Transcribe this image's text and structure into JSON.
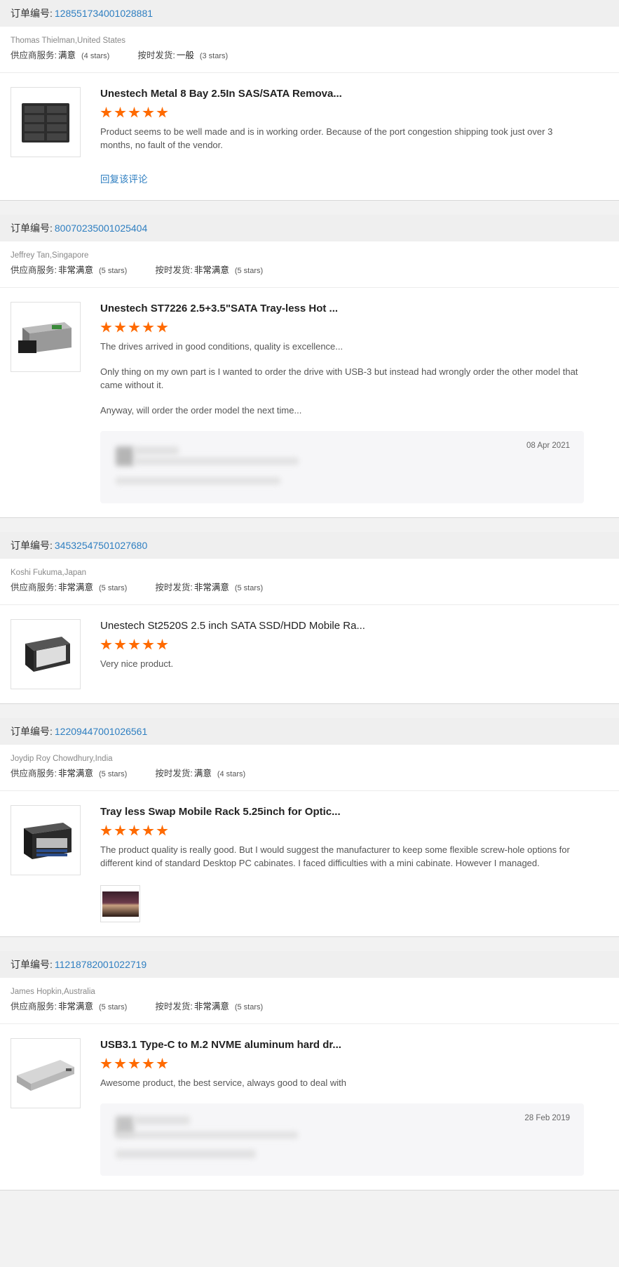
{
  "labels": {
    "order_no": "订单编号:",
    "supplier_service": "供应商服务:",
    "on_time": "按时发货:",
    "reply": "回复该评论"
  },
  "colors": {
    "accent": "#2f7fc1",
    "star": "#ff6a00",
    "header_bg": "#efefef"
  },
  "orders": [
    {
      "order_number": "128551734001028881",
      "buyer": "Thomas Thielman,United States",
      "service": {
        "value": "满意",
        "stars": "(4 stars)"
      },
      "shipping": {
        "value": "一般",
        "stars": "(3 stars)"
      },
      "product_title": "Unestech Metal 8 Bay 2.5In SAS/SATA Remova...",
      "rating": 5,
      "text": [
        "Product seems to be well made and is in working order. Because of the port congestion shipping took just over 3 months, no fault of the vendor."
      ],
      "has_reply_link": true
    },
    {
      "order_number": "80070235001025404",
      "buyer": "Jeffrey Tan,Singapore",
      "service": {
        "value": "非常满意",
        "stars": "(5 stars)"
      },
      "shipping": {
        "value": "非常满意",
        "stars": "(5 stars)"
      },
      "product_title": "Unestech ST7226 2.5+3.5\"SATA Tray-less Hot ...",
      "rating": 5,
      "text": [
        "The drives arrived in good conditions, quality is excellence...",
        "Only thing on my own part is I wanted to order the drive with USB-3 but instead had wrongly order the other model that came without it.",
        "Anyway, will order the order model the next time..."
      ],
      "seller_reply_date": "08 Apr 2021"
    },
    {
      "order_number": "34532547501027680",
      "buyer": "Koshi Fukuma,Japan",
      "service": {
        "value": "非常满意",
        "stars": "(5 stars)"
      },
      "shipping": {
        "value": "非常满意",
        "stars": "(5 stars)"
      },
      "product_title": "Unestech St2520S 2.5 inch SATA SSD/HDD Mobile Ra...",
      "rating": 5,
      "text": [
        "Very nice product."
      ]
    },
    {
      "order_number": "12209447001026561",
      "buyer": "Joydip Roy Chowdhury,India",
      "service": {
        "value": "非常满意",
        "stars": "(5 stars)"
      },
      "shipping": {
        "value": "满意",
        "stars": "(4 stars)"
      },
      "product_title": "Tray less Swap Mobile Rack 5.25inch for Optic...",
      "rating": 5,
      "text": [
        "The product quality is really good. But I would suggest the manufacturer to keep some flexible screw-hole options for different kind of standard Desktop PC cabinates. I faced difficulties with a mini cabinate. However I managed."
      ],
      "has_photo": true
    },
    {
      "order_number": "11218782001022719",
      "buyer": "James Hopkin,Australia",
      "service": {
        "value": "非常满意",
        "stars": "(5 stars)"
      },
      "shipping": {
        "value": "非常满意",
        "stars": "(5 stars)"
      },
      "product_title": "USB3.1 Type-C to M.2 NVME aluminum hard dr...",
      "rating": 5,
      "text": [
        "Awesome product, the best service, always good to deal with"
      ],
      "seller_reply_date": "28 Feb 2019"
    }
  ]
}
